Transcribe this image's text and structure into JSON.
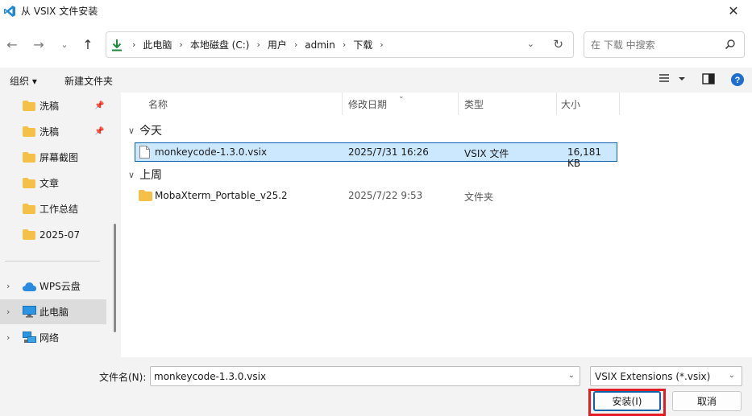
{
  "window": {
    "title": "从 VSIX 文件安装"
  },
  "address": {
    "crumbs": [
      "此电脑",
      "本地磁盘 (C:)",
      "用户",
      "admin",
      "下载"
    ]
  },
  "search": {
    "placeholder": "在 下载 中搜索"
  },
  "toolbar": {
    "organize_label": "组织 ▾",
    "new_folder_label": "新建文件夹"
  },
  "sidebar": {
    "items": [
      {
        "label": "洗稿",
        "pinned": true
      },
      {
        "label": "洗稿",
        "pinned": true
      },
      {
        "label": "屏幕截图"
      },
      {
        "label": "文章"
      },
      {
        "label": "工作总结"
      },
      {
        "label": "2025-07"
      },
      {
        "label": "WPS云盘"
      },
      {
        "label": "此电脑",
        "selected": true
      },
      {
        "label": "网络"
      }
    ]
  },
  "columns": {
    "name": "名称",
    "modified": "修改日期",
    "type": "类型",
    "size": "大小"
  },
  "groups": [
    {
      "label": "今天",
      "files": [
        {
          "name": "monkeycode-1.3.0.vsix",
          "modified": "2025/7/31 16:26",
          "type": "VSIX 文件",
          "size": "16,181 KB",
          "selected": true
        }
      ]
    },
    {
      "label": "上周",
      "files": [
        {
          "name": "MobaXterm_Portable_v25.2",
          "modified": "2025/7/22 9:53",
          "type": "文件夹",
          "size": ""
        }
      ]
    }
  ],
  "footer": {
    "filename_label": "文件名(N):",
    "filename_value": "monkeycode-1.3.0.vsix",
    "filter_value": "VSIX Extensions (*.vsix)",
    "install_label": "安装(I)",
    "cancel_label": "取消"
  },
  "colors": {
    "accent": "#0f62a8",
    "highlight": "#e31d25",
    "selection": "#cce8ff",
    "folder": "#f4c048"
  }
}
